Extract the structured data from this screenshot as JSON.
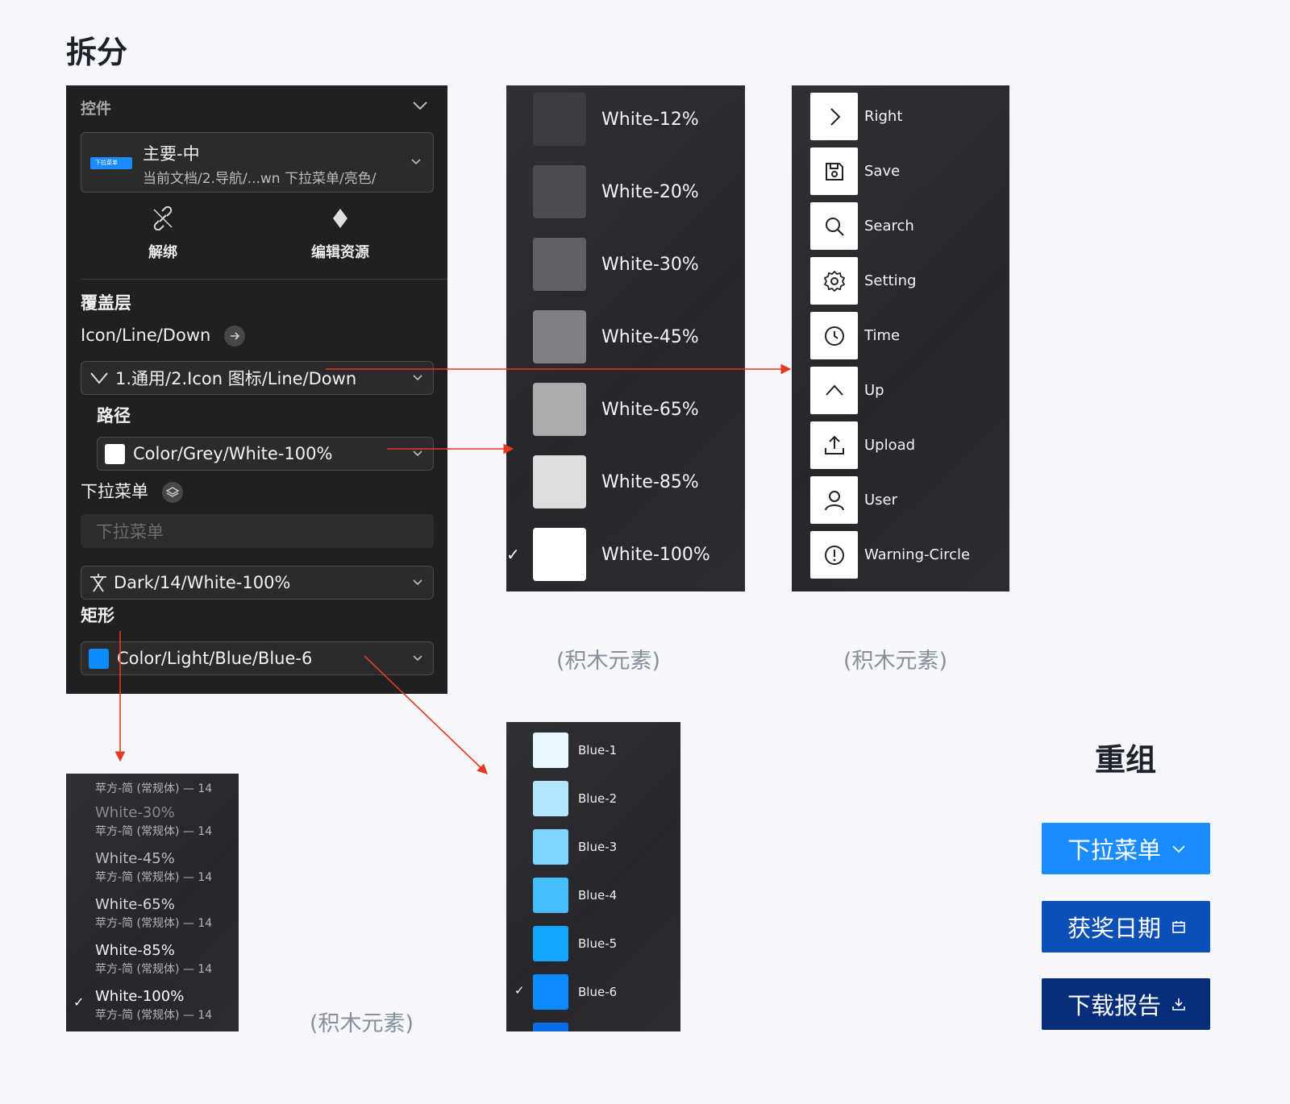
{
  "titles": {
    "split": "拆分",
    "recompose": "重组"
  },
  "panel": {
    "header": "控件",
    "component": {
      "thumb": "下拉菜单",
      "name": "主要-中",
      "path": "当前文档/2.导航/...wn 下拉菜单/亮色/"
    },
    "actions": {
      "unbind": "解绑",
      "edit_resource": "编辑资源"
    },
    "overlay_title": "覆盖层",
    "icon_label": "Icon/Line/Down",
    "icon_value": "1.通用/2.Icon 图标/Line/Down",
    "path_label": "路径",
    "path_value": "Color/Grey/White-100%",
    "dropdown_label": "下拉菜单",
    "dropdown_placeholder": "下拉菜单",
    "text_style_value": "Dark/14/White-100%",
    "rect_label": "矩形",
    "rect_value": "Color/Light/Blue/Blue-6"
  },
  "whites": {
    "items": [
      {
        "label": "White-12%",
        "color": "#3b3c40"
      },
      {
        "label": "White-20%",
        "color": "#4b4c50"
      },
      {
        "label": "White-30%",
        "color": "#5f6064"
      },
      {
        "label": "White-45%",
        "color": "#7f8083"
      },
      {
        "label": "White-65%",
        "color": "#abacae"
      },
      {
        "label": "White-85%",
        "color": "#dcdddd"
      },
      {
        "label": "White-100%",
        "color": "#ffffff"
      }
    ],
    "check": "✓"
  },
  "icons": {
    "items": [
      {
        "label": "Right",
        "icon": "chevron-right-icon"
      },
      {
        "label": "Save",
        "icon": "save-icon"
      },
      {
        "label": "Search",
        "icon": "search-icon"
      },
      {
        "label": "Setting",
        "icon": "gear-icon"
      },
      {
        "label": "Time",
        "icon": "clock-icon"
      },
      {
        "label": "Up",
        "icon": "chevron-up-icon"
      },
      {
        "label": "Upload",
        "icon": "upload-icon"
      },
      {
        "label": "User",
        "icon": "user-icon"
      },
      {
        "label": "Warning-Circle",
        "icon": "warning-circle-icon"
      }
    ]
  },
  "text_styles": {
    "first_sub": "苹方-简 (常规体) — 14",
    "items": [
      {
        "main": "White-30%",
        "sub": "苹方-简 (常规体) — 14"
      },
      {
        "main": "White-45%",
        "sub": "苹方-简 (常规体) — 14"
      },
      {
        "main": "White-65%",
        "sub": "苹方-简 (常规体) — 14"
      },
      {
        "main": "White-85%",
        "sub": "苹方-简 (常规体) — 14"
      },
      {
        "main": "White-100%",
        "sub": "苹方-简 (常规体) — 14"
      }
    ],
    "check": "✓"
  },
  "blues": {
    "items": [
      {
        "label": "Blue-1",
        "color": "#e8f7ff"
      },
      {
        "label": "Blue-2",
        "color": "#b5e6ff"
      },
      {
        "label": "Blue-3",
        "color": "#7fd3ff"
      },
      {
        "label": "Blue-4",
        "color": "#45bdff"
      },
      {
        "label": "Blue-5",
        "color": "#12a5ff"
      },
      {
        "label": "Blue-6",
        "color": "#0b8bff"
      }
    ],
    "check": "✓"
  },
  "captions": {
    "blocks_1": "(积木元素)",
    "blocks_2": "(积木元素)",
    "blocks_3": "(积木元素)"
  },
  "buttons": [
    {
      "label": "下拉菜单",
      "color": "#1a8cff",
      "icon": "chevron-down-icon"
    },
    {
      "label": "获奖日期",
      "color": "#0b4fb8",
      "icon": "calendar-icon"
    },
    {
      "label": "下载报告",
      "color": "#062d7a",
      "icon": "download-icon"
    }
  ],
  "colors": {
    "arrow": "#e8391f",
    "blue6": "#0b8bff"
  }
}
